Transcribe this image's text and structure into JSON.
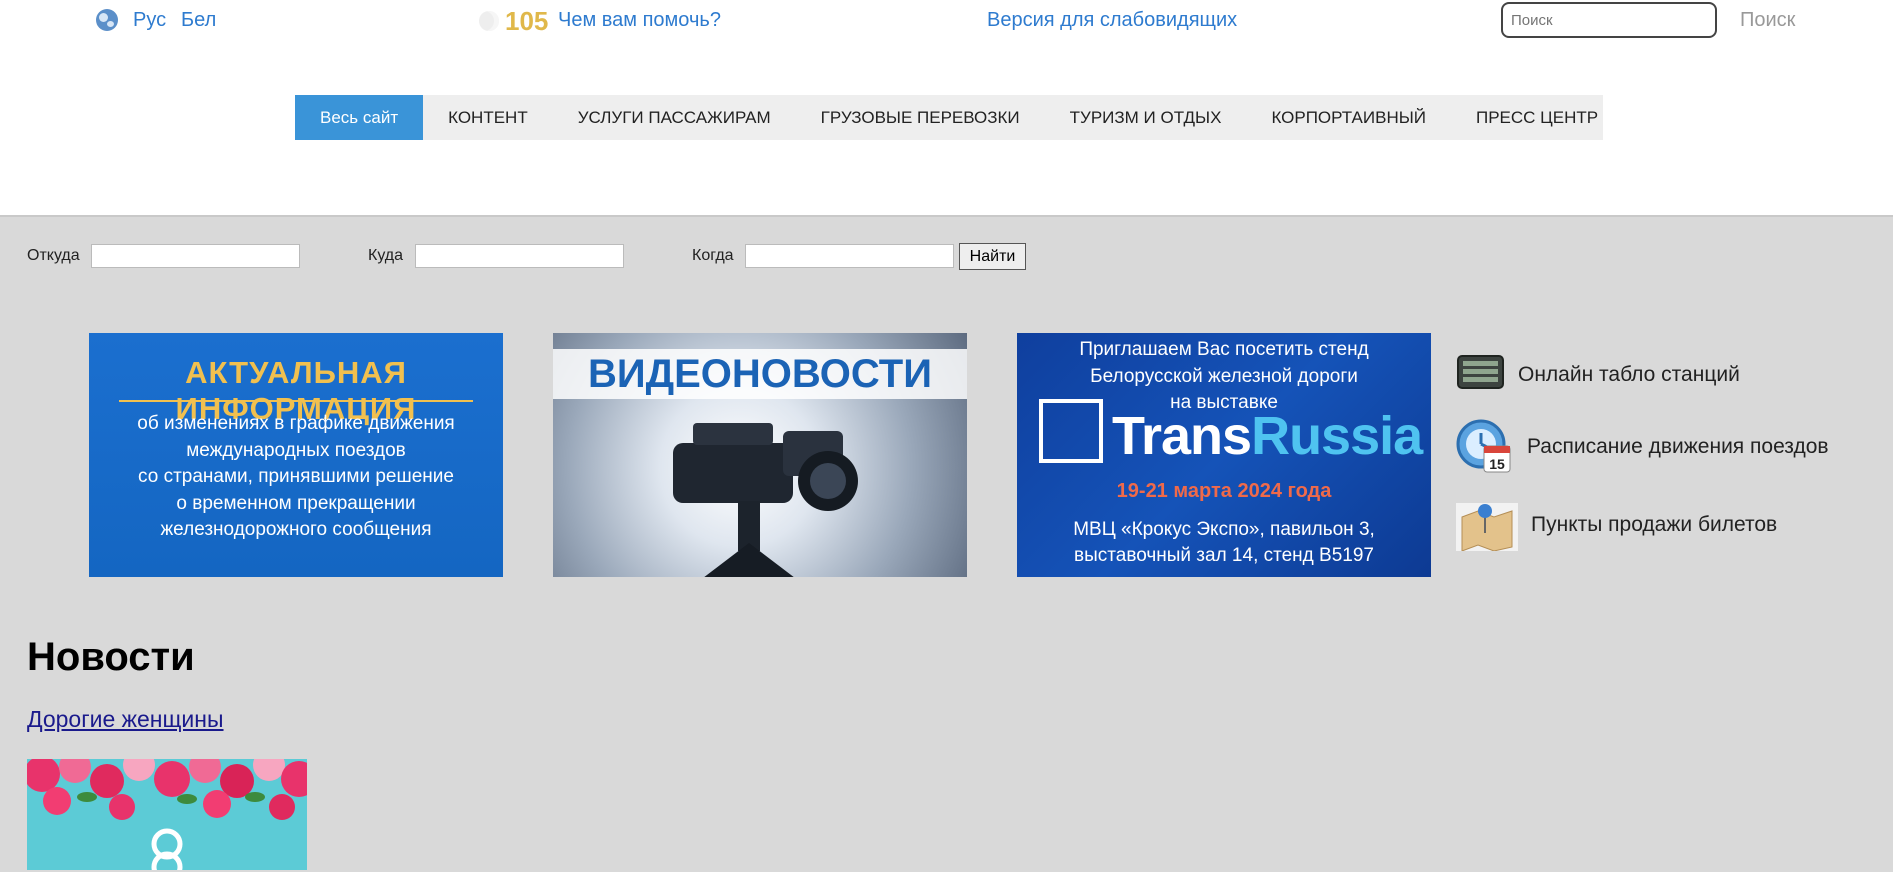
{
  "topbar": {
    "lang_ru": "Рус",
    "lang_be": "Бел",
    "phone_number": "105",
    "help_link": "Чем вам помочь?",
    "vision_link": "Версия для слабовидящих",
    "search_placeholder": "Поиск",
    "search_button": "Поиск"
  },
  "nav": {
    "items": [
      {
        "label": "Весь сайт",
        "active": true
      },
      {
        "label": "КОНТЕНТ"
      },
      {
        "label": "УСЛУГИ ПАССАЖИРАМ"
      },
      {
        "label": "ГРУЗОВЫЕ ПЕРЕВОЗКИ"
      },
      {
        "label": "ТУРИЗМ И ОТДЫХ"
      },
      {
        "label": "КОРПОРТАИВНЫЙ"
      },
      {
        "label": "ПРЕСС ЦЕНТР"
      }
    ]
  },
  "route_form": {
    "from_label": "Откуда",
    "to_label": "Куда",
    "when_label": "Когда",
    "find_button": "Найти"
  },
  "banners": {
    "info": {
      "title": "АКТУАЛЬНАЯ ИНФОРМАЦИЯ",
      "lines": [
        "об изменениях в графике движения",
        "международных поездов",
        "со странами, принявшими решение",
        "о временном прекращении",
        "железнодорожного сообщения"
      ]
    },
    "video": {
      "title": "ВИДЕОНОВОСТИ"
    },
    "expo": {
      "invite_lines": [
        "Приглашаем Вас посетить стенд",
        "Белорусской железной дороги",
        "на выставке"
      ],
      "brand_a": "Trans",
      "brand_b": "Russia",
      "dates": "19-21 марта 2024 года",
      "venue_lines": [
        "МВЦ «Крокус Экспо», павильон 3,",
        "выставочный зал 14, стенд B5197"
      ]
    }
  },
  "quick_links": [
    {
      "label": "Онлайн табло станций",
      "icon": "station-board-icon"
    },
    {
      "label": "Расписание движения поездов",
      "icon": "schedule-icon"
    },
    {
      "label": "Пункты продажи билетов",
      "icon": "map-pin-icon"
    }
  ],
  "calendar_day": "15",
  "news": {
    "heading": "Новости",
    "item_title": "Дорогие женщины"
  },
  "colors": {
    "accent": "#3a94d8",
    "link": "#2e7bcf",
    "content_bg": "#d9d9d9"
  }
}
